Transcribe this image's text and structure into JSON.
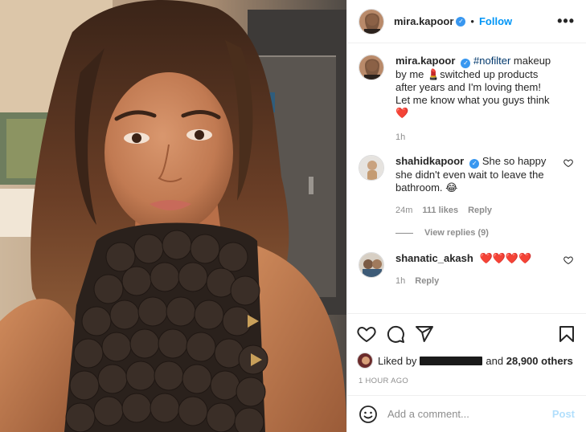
{
  "post": {
    "author": "mira.kapoor",
    "follow_label": "Follow",
    "separator": "•",
    "more_label": "•••",
    "verified_mark": "✓"
  },
  "caption": {
    "author": "mira.kapoor",
    "hashtag": "#nofilter",
    "text_1": " makeup by me 💄switched up products after years and I'm loving them!",
    "text_2": "Let me know what you guys think ",
    "heart": "❤️",
    "age": "1h"
  },
  "comments": [
    {
      "author": "shahidkapoor",
      "text": "She so happy she didn't even wait to leave the bathroom. 😂",
      "age": "24m",
      "likes": "111 likes",
      "reply_label": "Reply",
      "view_replies": "View replies (9)"
    },
    {
      "author": "shanatic_akash",
      "text": "❤️❤️❤️❤️",
      "age": "1h",
      "reply_label": "Reply"
    }
  ],
  "likes": {
    "prefix": "Liked by ",
    "suffix": " and ",
    "others": "28,900 others"
  },
  "timestamp": "1 HOUR AGO",
  "add_comment": {
    "placeholder": "Add a comment...",
    "post_label": "Post"
  },
  "colors": {
    "accent": "#0095f6",
    "heart": "#ed4956",
    "muted": "#8e8e8e"
  }
}
